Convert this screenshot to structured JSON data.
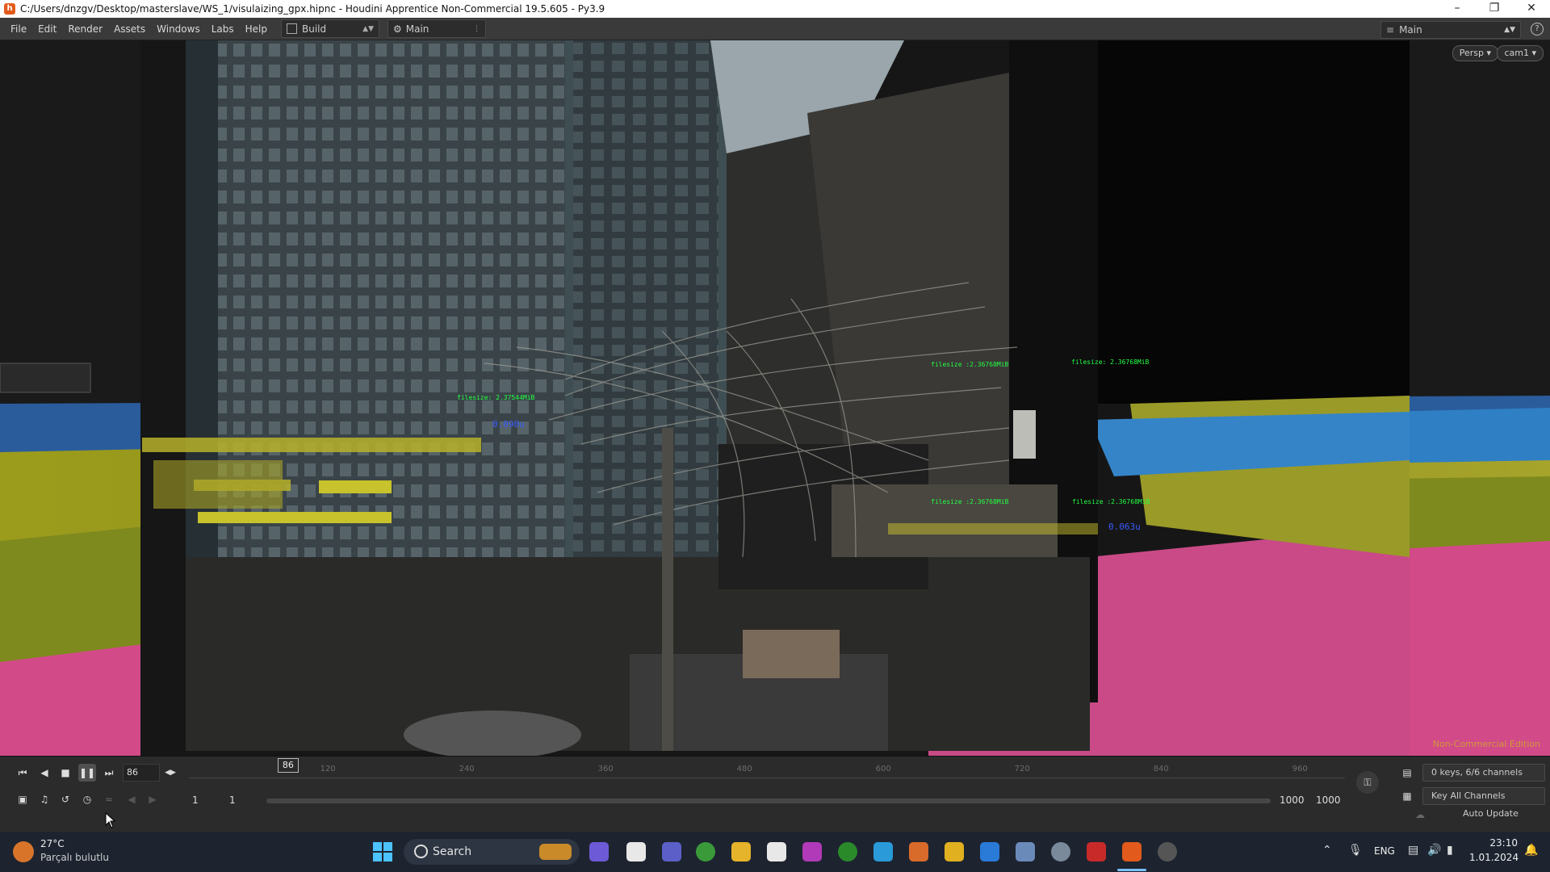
{
  "window": {
    "title": "C:/Users/dnzgv/Desktop/masterslave/WS_1/visulaizing_gpx.hipnc - Houdini Apprentice Non-Commercial 19.5.605 - Py3.9"
  },
  "menubar": {
    "items": [
      "File",
      "Edit",
      "Render",
      "Assets",
      "Windows",
      "Labs",
      "Help"
    ],
    "desktop_label": "Build",
    "network_label": "Main",
    "right_label": "Main"
  },
  "viewport": {
    "persp_label": "Persp ▾",
    "cam_label": "cam1 ▾",
    "watermark": "Non-Commercial Edition",
    "overlays": [
      {
        "text": "filesize :2.36768MiB",
        "color": "g"
      },
      {
        "text": "filesize: 2.36768MiB",
        "color": "g"
      },
      {
        "text": "filesize :2.36768MiB",
        "color": "g"
      },
      {
        "text": "filesize :2.36768MiB",
        "color": "g"
      },
      {
        "text": "0.063u",
        "color": "b"
      },
      {
        "text": "0.090u",
        "color": "b"
      },
      {
        "text": "filesize: 2.37544MiB",
        "color": "g"
      }
    ]
  },
  "timeline": {
    "current_frame": "86",
    "playhead_label": "86",
    "ticks": [
      "120",
      "240",
      "360",
      "480",
      "600",
      "720",
      "840",
      "960"
    ],
    "range_start": "1",
    "range_start2": "1",
    "range_end": "1000",
    "range_end2": "1000",
    "keys_info": "0 keys, 6/6 channels",
    "key_all_channels": "Key All Channels",
    "auto_update": "Auto Update"
  },
  "taskbar": {
    "weather_temp": "27°C",
    "weather_desc": "Parçalı bulutlu",
    "search_placeholder": "Search",
    "lang": "ENG",
    "time": "23:10",
    "date": "1.01.2024"
  }
}
